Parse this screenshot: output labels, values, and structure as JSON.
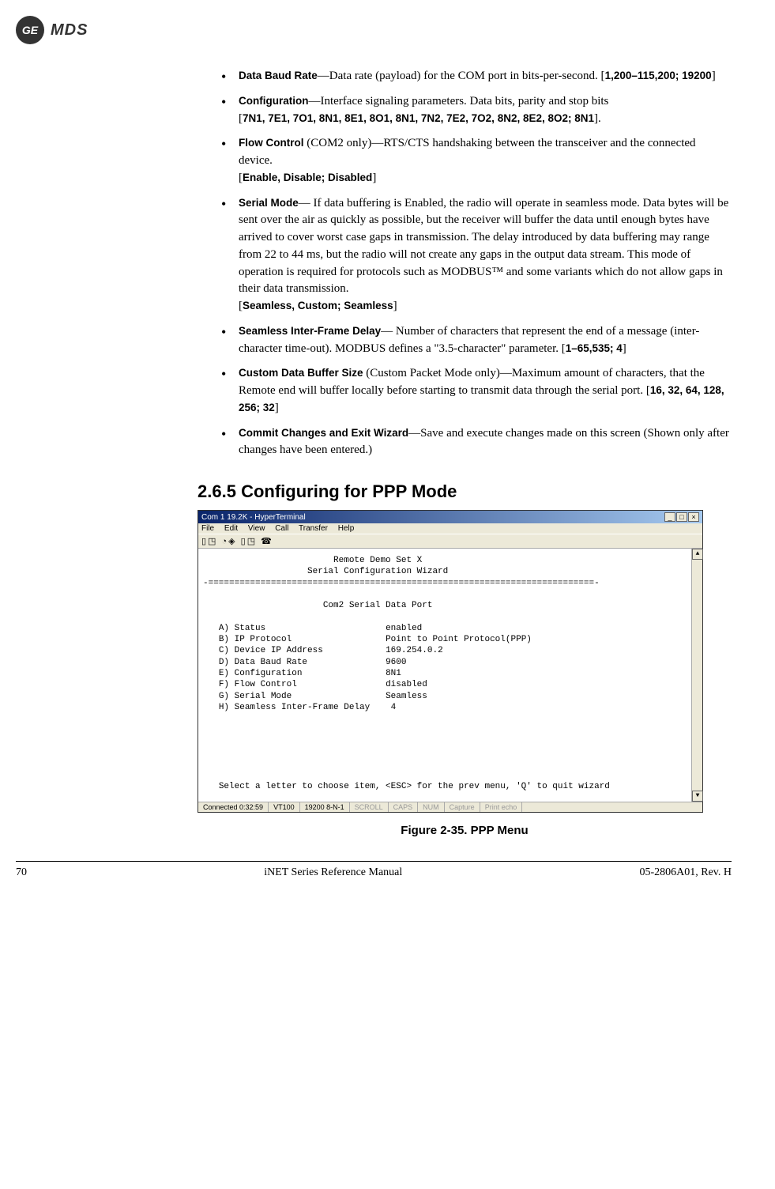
{
  "header": {
    "badge": "GE",
    "brand": "MDS"
  },
  "items": {
    "baud": {
      "term": "Data Baud Rate",
      "text_a": "—Data rate (payload) for the ",
      "com": "COM",
      "text_b": " port in bits-per-second. [",
      "range": "1,200–115,200; 19200",
      "tail": "]"
    },
    "config": {
      "term": "Configuration",
      "text": "—Interface signaling parameters. Data bits, parity and stop bits",
      "range_open": "[",
      "range": "7N1, 7E1, 7O1, 8N1, 8E1, 8O1, 8N1, 7N2, 7E2, 7O2, 8N2, 8E2, 8O2; 8N1",
      "range_close": "]."
    },
    "flow": {
      "term": "Flow Control",
      "text_a": " (COM2 only)—RTS/CTS handshaking between the transceiver and the connected device.",
      "range_open": "[",
      "range": "Enable, Disable; Disabled",
      "range_close": "]"
    },
    "serial": {
      "term": "Serial Mode",
      "text": "— If data buffering is Enabled, the radio will operate in seamless mode. Data bytes will be sent over the air as quickly as possible, but the receiver will buffer the data until enough bytes have arrived to cover worst case gaps in transmission. The delay introduced by data buffering may range from 22 to 44 ms, but the radio will not create any gaps in the output data stream. This mode of operation is required for protocols such as MODBUS™ and some variants which do not allow gaps in their data transmission.",
      "range_open": "[",
      "range": "Seamless, Custom; Seamless",
      "range_close": "]"
    },
    "seamless": {
      "term": "Seamless Inter-Frame Delay",
      "text": "— Number of characters that represent the end of a message (inter-character time-out). MODBUS defines a \"3.5-character\" parameter. [",
      "range": "1–65,535; 4",
      "tail": "]"
    },
    "custom": {
      "term": "Custom Data Buffer Size",
      "text": " (Custom Packet Mode only)—Maximum amount of characters, that the Remote end will buffer locally before starting to transmit data through the serial port. [",
      "range": "16, 32, 64, 128, 256; 32",
      "tail": "]"
    },
    "commit": {
      "term": "Commit Changes and Exit Wizard",
      "text": "—Save and execute changes made on this screen (Shown only after changes have been entered.)"
    }
  },
  "section": {
    "number": "2.6.5",
    "title": "Configuring for PPP Mode"
  },
  "terminal": {
    "window_title": "Com 1 19.2K - HyperTerminal",
    "menus": {
      "file": "File",
      "edit": "Edit",
      "view": "View",
      "call": "Call",
      "transfer": "Transfer",
      "help": "Help"
    },
    "title1": "Remote Demo Set X",
    "title2": "Serial Configuration Wizard",
    "divider": "-==========================================================================-",
    "subtitle": "Com2 Serial Data Port",
    "rows": {
      "a": {
        "label": "A) Status",
        "value": "enabled"
      },
      "b": {
        "label": "B) IP Protocol",
        "value": "Point to Point Protocol(PPP)"
      },
      "c": {
        "label": "C) Device IP Address",
        "value": "169.254.0.2"
      },
      "d": {
        "label": "D) Data Baud Rate",
        "value": "9600"
      },
      "e": {
        "label": "E) Configuration",
        "value": "8N1"
      },
      "f": {
        "label": "F) Flow Control",
        "value": "disabled"
      },
      "g": {
        "label": "G) Serial Mode",
        "value": "Seamless"
      },
      "h": {
        "label": "H) Seamless Inter-Frame Delay",
        "value": "4"
      }
    },
    "prompt": "Select a letter to choose item, <ESC> for the prev menu, 'Q' to quit wizard",
    "status": {
      "connected": "Connected 0:32:59",
      "emulation": "VT100",
      "settings": "19200 8-N-1",
      "scroll": "SCROLL",
      "caps": "CAPS",
      "num": "NUM",
      "capture": "Capture",
      "printecho": "Print echo"
    }
  },
  "figure": {
    "label": "Figure 2-35. PPP Menu"
  },
  "footer": {
    "page": "70",
    "doc": "iNET Series Reference Manual",
    "rev": "05-2806A01, Rev. H"
  }
}
